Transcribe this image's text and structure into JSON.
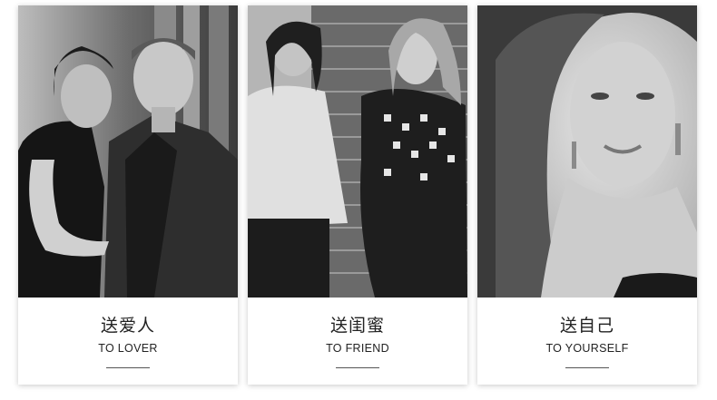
{
  "cards": [
    {
      "title_cn": "送爱人",
      "title_en": "TO LOVER",
      "photo_icon": "couple-photo"
    },
    {
      "title_cn": "送闺蜜",
      "title_en": "TO FRIEND",
      "photo_icon": "friends-photo"
    },
    {
      "title_cn": "送自己",
      "title_en": "TO YOURSELF",
      "photo_icon": "woman-portrait-photo"
    }
  ]
}
